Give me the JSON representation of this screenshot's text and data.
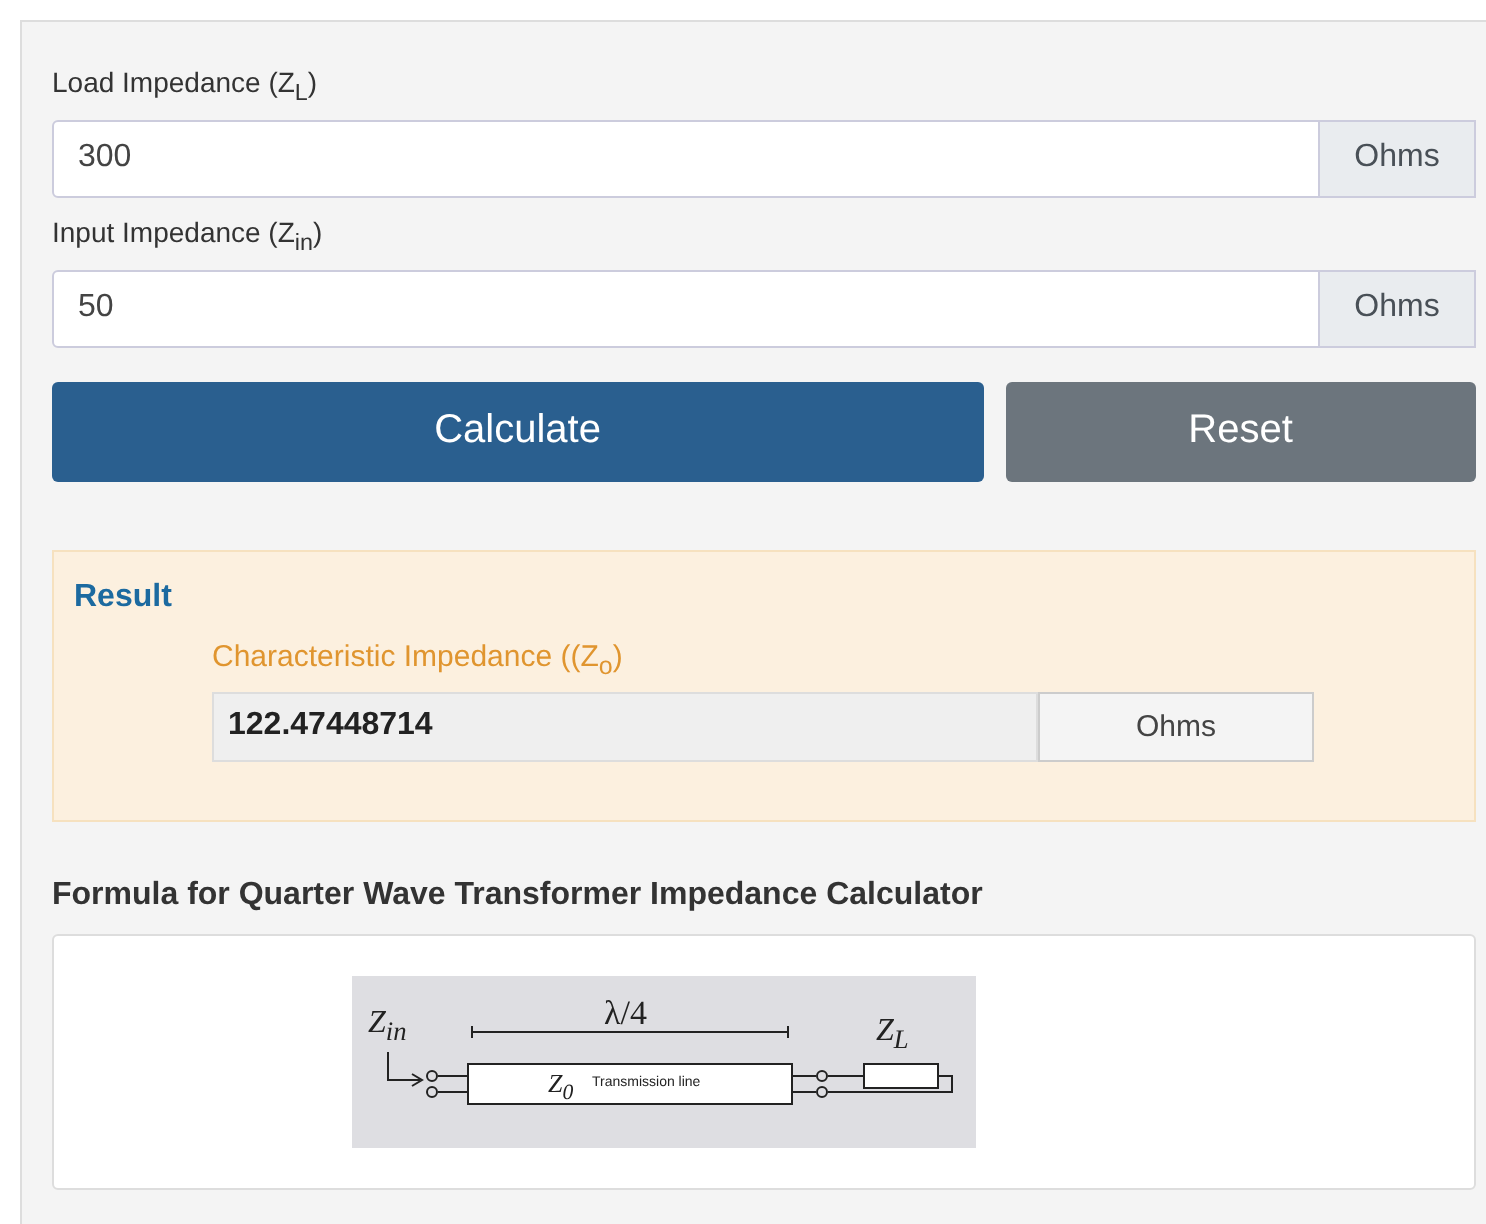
{
  "fields": [
    {
      "label": "Load Impedance (Z$_{L}$)",
      "value": "300",
      "unit": "Ohms"
    },
    {
      "label": "Input Impedance (Z$_{in}$)",
      "value": "50",
      "unit": "Ohms"
    }
  ],
  "buttons": [
    {
      "label": "Calculate",
      "kind": "primary"
    },
    {
      "label": "Reset",
      "kind": "secondary"
    }
  ],
  "result": {
    "title": "Result",
    "label": "Characteristic Impedance ((Z$_{o}$)",
    "value": "122.47448714",
    "unit": "Ohms"
  },
  "formula": {
    "heading": "Formula for Quarter Wave Transformer Impedance Calculator",
    "diagram": {
      "zin": "Z$_{in}$",
      "length": "λ/4",
      "zl": "Z$_{L}$",
      "z0": "Z$_{0}$",
      "line": "Transmission line"
    }
  }
}
